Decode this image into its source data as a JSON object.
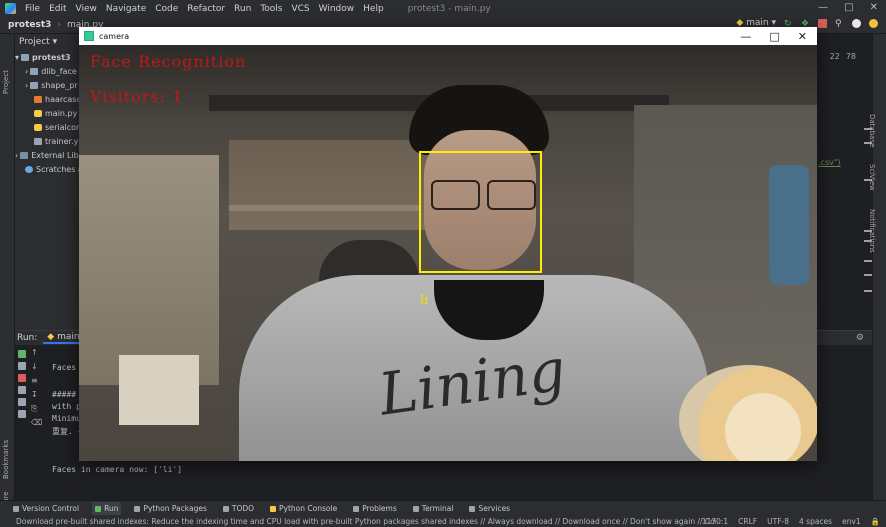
{
  "menubar": {
    "items": [
      "File",
      "Edit",
      "View",
      "Navigate",
      "Code",
      "Refactor",
      "Run",
      "Tools",
      "VCS",
      "Window",
      "Help"
    ],
    "title": "protest3 - main.py"
  },
  "navbar": {
    "project": "protest3",
    "file": "main.py",
    "run_config": "main",
    "counts": [
      "22",
      "78"
    ]
  },
  "project_panel": {
    "header": "Project",
    "items": [
      {
        "label": "protest3",
        "icon": "folder-icon"
      },
      {
        "label": "dlib_face",
        "icon": "folder-icon"
      },
      {
        "label": "shape_pr",
        "icon": "folder-icon"
      },
      {
        "label": "haarcasca",
        "icon": "xml-file-icon"
      },
      {
        "label": "main.py",
        "icon": "python-file-icon"
      },
      {
        "label": "serialcon",
        "icon": "python-file-icon"
      },
      {
        "label": "trainer.yn",
        "icon": "text-file-icon"
      },
      {
        "label": "External Libr",
        "icon": "library-icon"
      },
      {
        "label": "Scratches an",
        "icon": "scratch-icon"
      }
    ]
  },
  "editor": {
    "code_fragment": ".csv\")"
  },
  "left_strip": {
    "labels": [
      "Project",
      "Bookmarks",
      "Structure"
    ]
  },
  "right_strip": {
    "labels": [
      "Database",
      "SciView",
      "Notifications"
    ]
  },
  "run_panel": {
    "label": "Run:",
    "tab": "main",
    "lines": [
      "Faces",
      "#####",
      "with p",
      "Minimu",
      "重复. 子",
      "Faces in camera now: ['li']"
    ]
  },
  "camera_window": {
    "title": "camera",
    "overlay_title": "Face Recognition",
    "overlay_visitors": "Visitors: 1",
    "face_name": "li",
    "box_color": "#ffee00",
    "text_color": "#c01818"
  },
  "toolwindows": [
    {
      "label": "Version Control",
      "icon": "vcs-icon",
      "active": false
    },
    {
      "label": "Run",
      "icon": "run-icon",
      "active": true
    },
    {
      "label": "Python Packages",
      "icon": "packages-icon",
      "active": false
    },
    {
      "label": "TODO",
      "icon": "todo-icon",
      "active": false
    },
    {
      "label": "Python Console",
      "icon": "console-icon",
      "active": false
    },
    {
      "label": "Problems",
      "icon": "problems-icon",
      "active": false
    },
    {
      "label": "Terminal",
      "icon": "terminal-icon",
      "active": false
    },
    {
      "label": "Services",
      "icon": "services-icon",
      "active": false
    }
  ],
  "statusbar": {
    "message": "Download pre-built shared indexes: Reduce the indexing time and CPU load with pre-built Python packages shared indexes // Always download // Download once // Don't show again // Configure... (today 13:",
    "position": "1170:1",
    "line_sep": "CRLF",
    "encoding": "UTF-8",
    "indent": "4 spaces",
    "interpreter": "env1"
  }
}
